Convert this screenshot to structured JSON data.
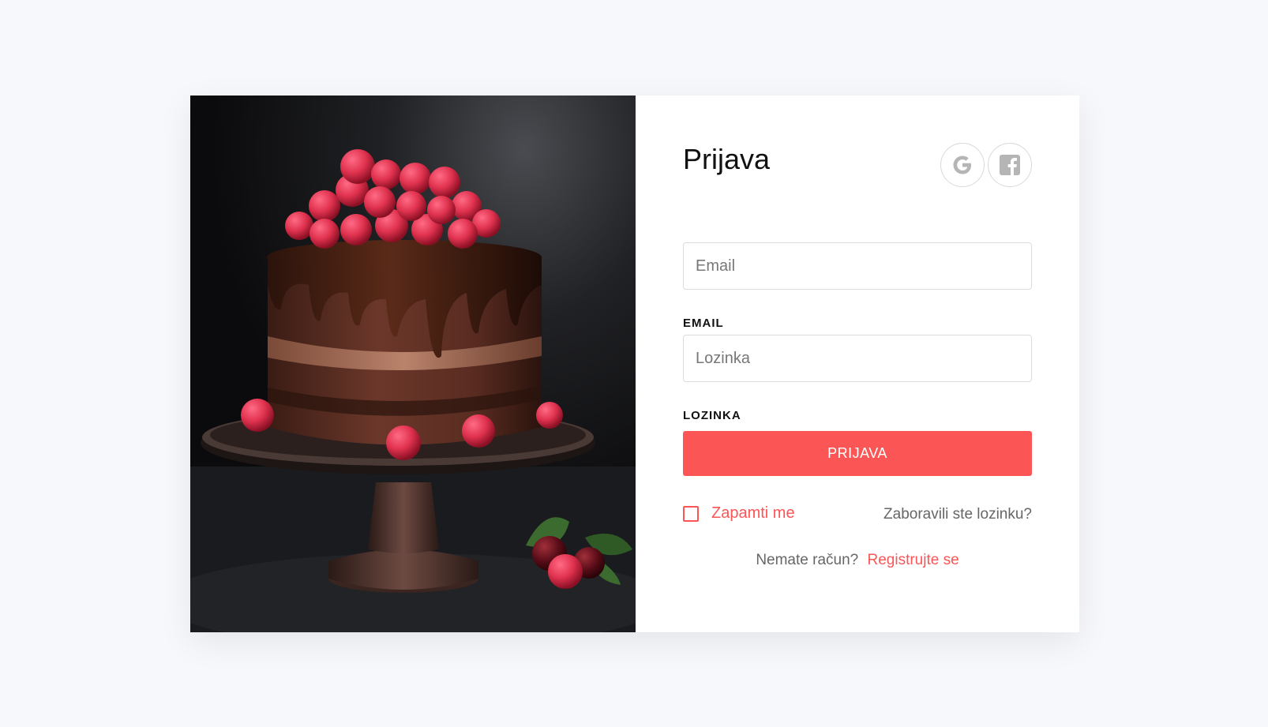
{
  "hero": {
    "image_name": "chocolate-raspberry-cake-photo"
  },
  "login": {
    "title": "Prijava",
    "social": [
      {
        "name": "google",
        "icon": "google-icon"
      },
      {
        "name": "facebook",
        "icon": "facebook-icon"
      }
    ],
    "email_label": "EMAIL",
    "email_placeholder": "Email",
    "email_value": "",
    "password_label": "LOZINKA",
    "password_placeholder": "Lozinka",
    "password_value": "",
    "submit_label": "PRIJAVA",
    "remember_label": "Zapamti me",
    "remember_checked": false,
    "forgot_label": "Zaboravili ste lozinku?",
    "no_account_text": "Nemate račun?",
    "register_label": "Registrujte se"
  },
  "colors": {
    "accent": "#fb5555",
    "background": "#f7f8fb",
    "muted_text": "#666666"
  }
}
